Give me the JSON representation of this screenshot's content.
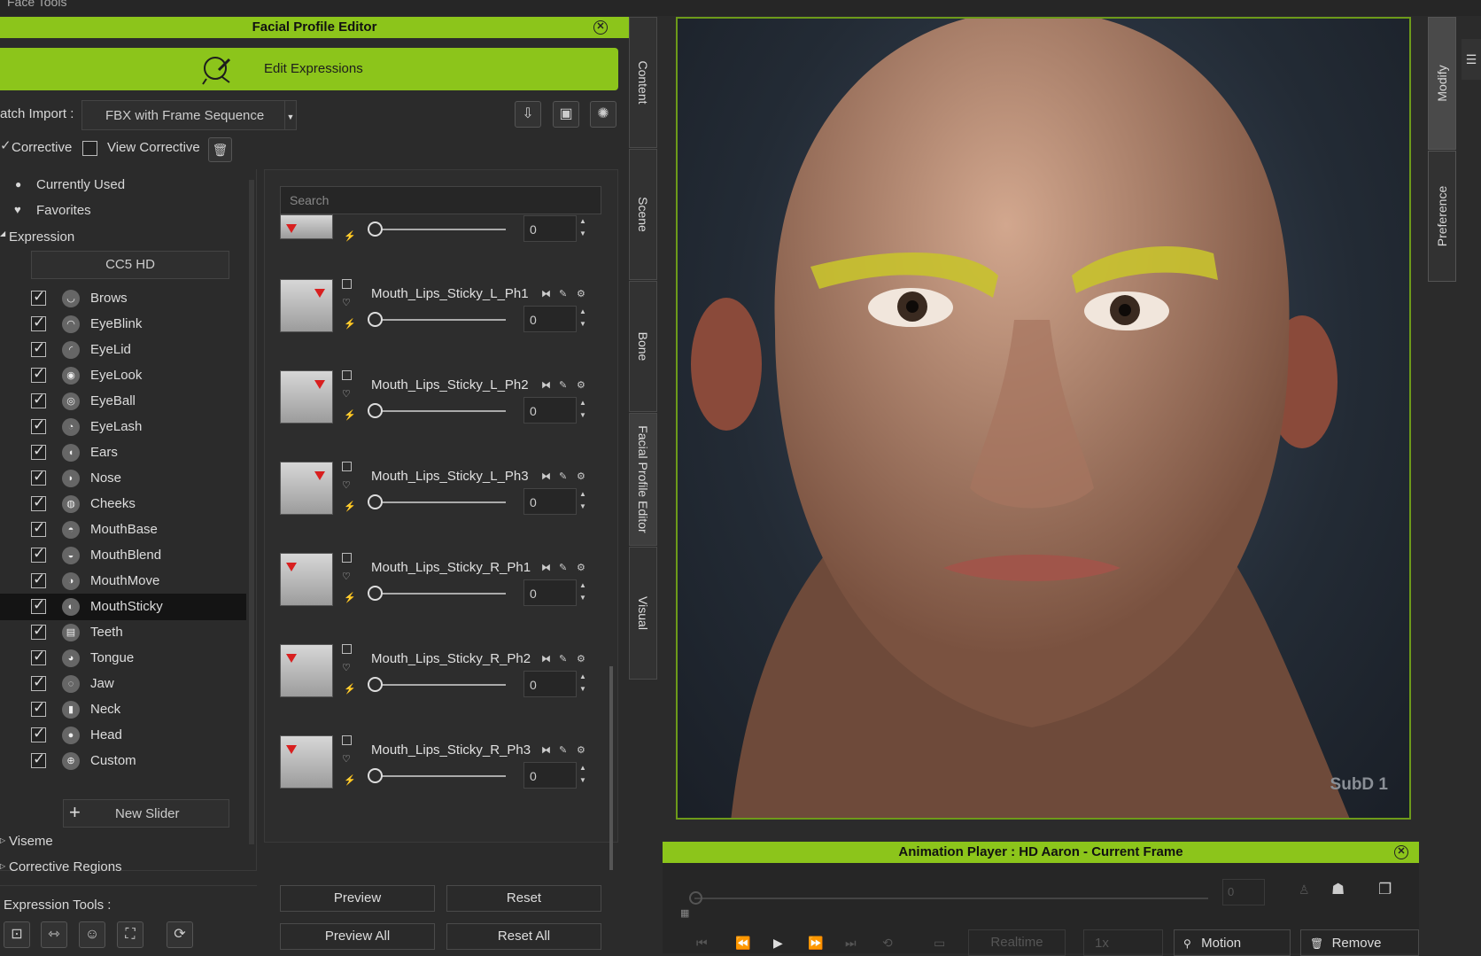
{
  "window": {
    "title": "Face Tools"
  },
  "editor": {
    "title": "Facial Profile Editor",
    "edit_expressions": "Edit Expressions",
    "batch_import_label": "atch Import :",
    "batch_import_value": "FBX with Frame Sequence",
    "corrective_label": "Corrective",
    "view_corrective_label": "View Corrective"
  },
  "tree": {
    "currently_used": "Currently Used",
    "favorites": "Favorites",
    "expression": "Expression",
    "profile": "CC5 HD",
    "new_slider": "New Slider",
    "viseme": "Viseme",
    "corrective_regions": "Corrective Regions",
    "selected": "MouthSticky",
    "items": [
      "Brows",
      "EyeBlink",
      "EyeLid",
      "EyeLook",
      "EyeBall",
      "EyeLash",
      "Ears",
      "Nose",
      "Cheeks",
      "MouthBase",
      "MouthBlend",
      "MouthMove",
      "MouthSticky",
      "Teeth",
      "Tongue",
      "Jaw",
      "Neck",
      "Head",
      "Custom"
    ]
  },
  "tools": {
    "label": "Expression Tools :"
  },
  "search": {
    "placeholder": "Search"
  },
  "morphs": [
    {
      "name": "",
      "value": "0",
      "side": "R"
    },
    {
      "name": "Mouth_Lips_Sticky_L_Ph1",
      "value": "0",
      "side": "L"
    },
    {
      "name": "Mouth_Lips_Sticky_L_Ph2",
      "value": "0",
      "side": "L"
    },
    {
      "name": "Mouth_Lips_Sticky_L_Ph3",
      "value": "0",
      "side": "L"
    },
    {
      "name": "Mouth_Lips_Sticky_R_Ph1",
      "value": "0",
      "side": "R"
    },
    {
      "name": "Mouth_Lips_Sticky_R_Ph2",
      "value": "0",
      "side": "R"
    },
    {
      "name": "Mouth_Lips_Sticky_R_Ph3",
      "value": "0",
      "side": "R"
    }
  ],
  "buttons": {
    "preview": "Preview",
    "reset": "Reset",
    "preview_all": "Preview All",
    "reset_all": "Reset All"
  },
  "side_tabs": {
    "content": "Content",
    "scene": "Scene",
    "bone": "Bone",
    "fpe": "Facial Profile Editor",
    "visual": "Visual",
    "modify": "Modify",
    "preference": "Preference"
  },
  "viewport": {
    "subd": "SubD 1"
  },
  "anim": {
    "title": "Animation Player : HD Aaron - Current Frame",
    "frame": "0",
    "realtime": "Realtime",
    "speed": "1x",
    "motion": "Motion",
    "remove": "Remove"
  },
  "colors": {
    "accent": "#8cc51b",
    "brow_highlight": "#c8c22e"
  }
}
